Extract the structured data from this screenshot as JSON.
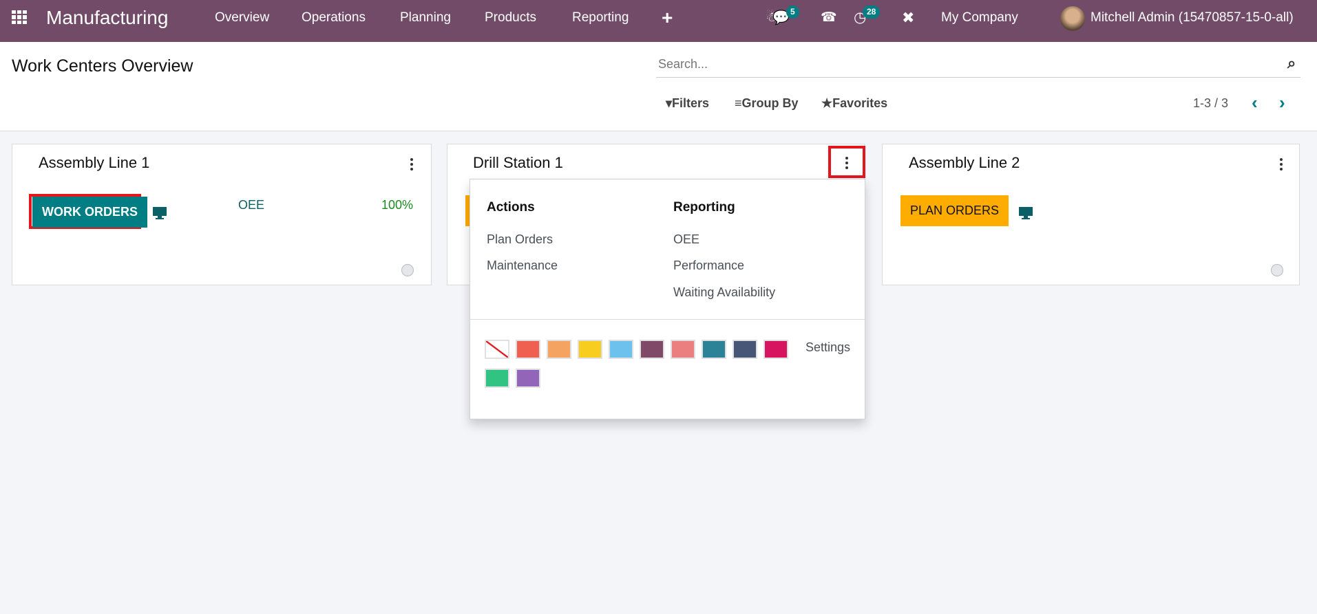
{
  "navbar": {
    "app_name": "Manufacturing",
    "menu": [
      "Overview",
      "Operations",
      "Planning",
      "Products",
      "Reporting"
    ],
    "plus": "+",
    "messages_badge": "5",
    "activities_badge": "28",
    "company": "My Company",
    "user": "Mitchell Admin (15470857-15-0-all)",
    "color": "#714b67"
  },
  "control_panel": {
    "title": "Work Centers Overview",
    "search_placeholder": "Search...",
    "filters": "Filters",
    "group_by": "Group By",
    "favorites": "Favorites",
    "pager": "1-3 / 3"
  },
  "cards": [
    {
      "title": "Assembly Line 1",
      "button": "WORK ORDERS",
      "button_color": "#017e84",
      "oee_label": "OEE",
      "oee_value": "100%"
    },
    {
      "title": "Drill Station 1",
      "button_color": "#ffac00"
    },
    {
      "title": "Assembly Line 2",
      "button": "PLAN ORDERS",
      "button_color": "#ffac00"
    }
  ],
  "dropdown": {
    "actions_title": "Actions",
    "actions": [
      "Plan Orders",
      "Maintenance"
    ],
    "reporting_title": "Reporting",
    "reporting": [
      "OEE",
      "Performance",
      "Waiting Availability"
    ],
    "settings": "Settings",
    "colors": [
      "none",
      "#f06050",
      "#f4a460",
      "#f7cd1f",
      "#6cc1ed",
      "#814968",
      "#eb7e7f",
      "#2c8397",
      "#475577",
      "#d6145f",
      "#30c381",
      "#9365b8"
    ]
  }
}
